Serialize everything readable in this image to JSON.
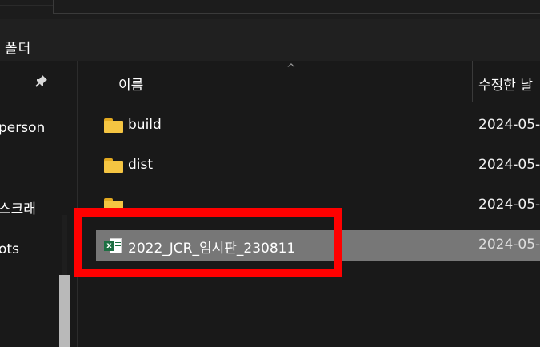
{
  "window": {
    "partial_title": "폴더"
  },
  "nav": {
    "items": [
      {
        "label": "person"
      },
      {
        "label": "스크래"
      },
      {
        "label": "ots"
      }
    ]
  },
  "columns": {
    "name": "이름",
    "modified": "수정한 날"
  },
  "files": [
    {
      "name": "build",
      "type": "folder",
      "date": "2024-05-"
    },
    {
      "name": "dist",
      "type": "folder",
      "date": "2024-05-"
    },
    {
      "name": "",
      "type": "folder",
      "date": "2024-05-"
    },
    {
      "name": "2022_JCR_임시판_230811",
      "type": "excel",
      "date": "2024-05-",
      "selected": true
    }
  ],
  "colors": {
    "selection": "#777777",
    "highlight": "#ff0000",
    "folder": "#f5c542",
    "excel": "#1d6f42"
  }
}
